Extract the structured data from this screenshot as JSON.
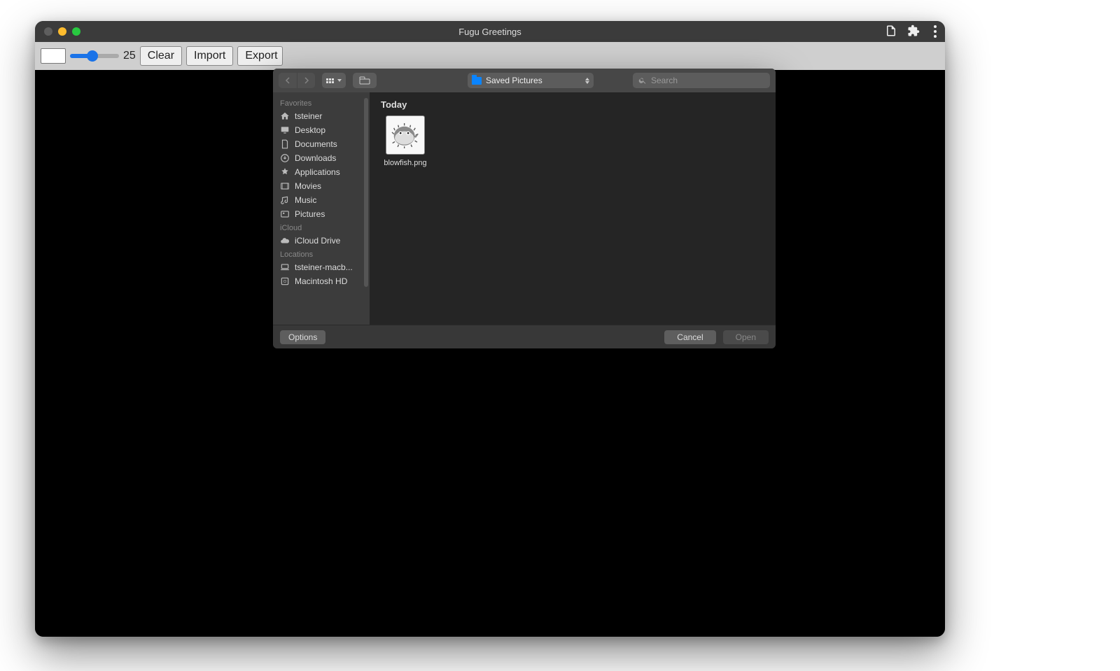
{
  "window": {
    "title": "Fugu Greetings"
  },
  "toolbar": {
    "slider_value": "25",
    "buttons": {
      "clear": "Clear",
      "import": "Import",
      "export": "Export"
    }
  },
  "dialog": {
    "location": "Saved Pictures",
    "search_placeholder": "Search",
    "sidebar": {
      "favorites_label": "Favorites",
      "favorites": [
        {
          "icon": "home",
          "label": "tsteiner"
        },
        {
          "icon": "desktop",
          "label": "Desktop"
        },
        {
          "icon": "doc",
          "label": "Documents"
        },
        {
          "icon": "download",
          "label": "Downloads"
        },
        {
          "icon": "apps",
          "label": "Applications"
        },
        {
          "icon": "movie",
          "label": "Movies"
        },
        {
          "icon": "music",
          "label": "Music"
        },
        {
          "icon": "photo",
          "label": "Pictures"
        }
      ],
      "icloud_label": "iCloud",
      "icloud": [
        {
          "icon": "cloud",
          "label": "iCloud Drive"
        }
      ],
      "locations_label": "Locations",
      "locations": [
        {
          "icon": "laptop",
          "label": "tsteiner-macb..."
        },
        {
          "icon": "disk",
          "label": "Macintosh HD"
        }
      ]
    },
    "content": {
      "section_today": "Today",
      "files": [
        {
          "name": "blowfish.png"
        }
      ]
    },
    "footer": {
      "options": "Options",
      "cancel": "Cancel",
      "open": "Open"
    }
  }
}
